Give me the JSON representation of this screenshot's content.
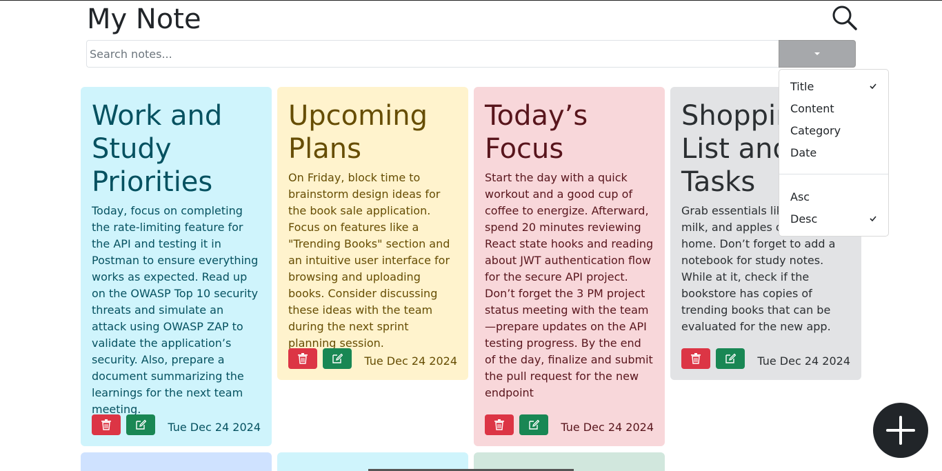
{
  "app": {
    "title": "My Note"
  },
  "search": {
    "placeholder": "Search notes..."
  },
  "sort_menu": {
    "fields": [
      {
        "label": "Title",
        "checked": true
      },
      {
        "label": "Content",
        "checked": false
      },
      {
        "label": "Category",
        "checked": false
      },
      {
        "label": "Date",
        "checked": false
      }
    ],
    "orders": [
      {
        "label": "Asc",
        "checked": false
      },
      {
        "label": "Desc",
        "checked": true
      }
    ]
  },
  "notes": [
    {
      "title": "Work and Study Priorities",
      "content": "Today, focus on completing the rate-limiting feature for the API and testing it in Postman to ensure everything works as expected. Read up on the OWASP Top 10 security threats and simulate an attack using OWASP ZAP to validate the application’s security. Also, prepare a document summarizing the learnings for the next team meeting.",
      "date": "Tue Dec 24 2024",
      "bg": "#cff4fc",
      "fg": "#055160"
    },
    {
      "title": "Upcoming Plans",
      "content": "On Friday, block time to brainstorm design ideas for the book sale application. Focus on features like a \"Trending Books\" section and an intuitive user interface for browsing and uploading books. Consider discussing these ideas with the team during the next sprint planning session.",
      "date": "Tue Dec 24 2024",
      "bg": "#fff3cd",
      "fg": "#664d03"
    },
    {
      "title": "Today’s Focus",
      "content": "Start the day with a quick workout and a good cup of coffee to energize. Afterward, spend 20 minutes reviewing React state hooks and reading about JWT authentication flow for the secure API project. Don’t forget the 3 PM project status meeting with the team—prepare updates on the API testing progress. By the end of the day, finalize and submit the pull request for the new endpoint",
      "date": "Tue Dec 24 2024",
      "bg": "#f8d7da",
      "fg": "#58151c"
    },
    {
      "title": "Shopping List and Tasks",
      "content": "Grab essentials like bread, milk, and apples on the way home. Don’t forget to add a notebook for study notes. While at it, check if the bookstore has copies of trending books that can be evaluated for the new app.",
      "date": "Tue Dec 24 2024",
      "bg": "#e2e3e5",
      "fg": "#2b2f32"
    }
  ],
  "partial_notes": [
    {
      "bg": "#cfe2ff",
      "fg": "#052c65"
    },
    {
      "bg": "#cff4fc",
      "fg": "#055160"
    },
    {
      "bg": "#d1e7dd",
      "fg": "#0a3622"
    }
  ],
  "colors": {
    "delete": "#dc3545",
    "edit": "#198754",
    "fab": "#212529",
    "sort_toggle": "#a6a8ab"
  }
}
